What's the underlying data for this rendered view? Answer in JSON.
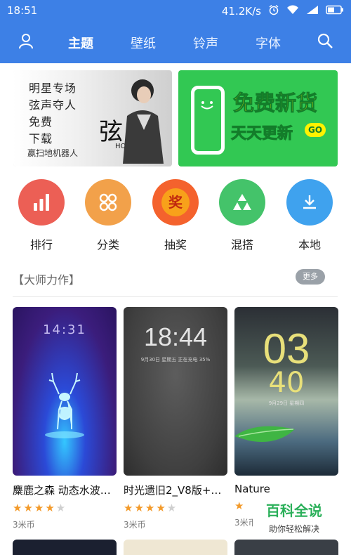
{
  "status_bar": {
    "time": "18:51",
    "network_speed": "41.2K/s",
    "icons": [
      "alarm-icon",
      "wifi-icon",
      "signal-icon",
      "battery-icon"
    ]
  },
  "nav": {
    "tabs": [
      {
        "label": "主题",
        "active": true
      },
      {
        "label": "壁纸",
        "active": false
      },
      {
        "label": "铃声",
        "active": false
      },
      {
        "label": "字体",
        "active": false
      }
    ],
    "accent_color": "#3d80e6"
  },
  "banners": {
    "left": {
      "lines": [
        "明星专场",
        "弦声夺人",
        "免费",
        "下载"
      ],
      "big_char": "弦",
      "caption": "赢扫地机器人",
      "subcaption": "HOU XIAN"
    },
    "right": {
      "title": "免费新货",
      "subtitle": "天天更新",
      "badge": "GO"
    }
  },
  "categories": [
    {
      "label": "排行",
      "color": "#ec5f55",
      "icon": "bar-chart-icon"
    },
    {
      "label": "分类",
      "color": "#f2a14a",
      "icon": "grid-circles-icon"
    },
    {
      "label": "抽奖",
      "color": "#f4622d",
      "icon": "prize-icon",
      "glyph": "奖"
    },
    {
      "label": "混搭",
      "color": "#44c36a",
      "icon": "triangles-icon"
    },
    {
      "label": "本地",
      "color": "#3fa2ee",
      "icon": "download-icon"
    }
  ],
  "section": {
    "title": "【大师力作】",
    "more_label": "更多"
  },
  "themes": [
    {
      "name": "麋鹿之森 动态水波…",
      "rating": 4.5,
      "price": "3米币",
      "clock": "14:31"
    },
    {
      "name": "时光遗旧2_V8版+…",
      "rating": 4.5,
      "price": "3米币",
      "clock": "18:44",
      "sub": "9月30日 星期五\n正在充电 35%"
    },
    {
      "name": "Nature",
      "rating": 1,
      "price": "3米币",
      "clock_top": "03",
      "clock_bottom": "40",
      "sub": "9月29日 星期四"
    }
  ],
  "watermark": {
    "title": "百科全说",
    "subtitle": "助你轻松解决"
  }
}
